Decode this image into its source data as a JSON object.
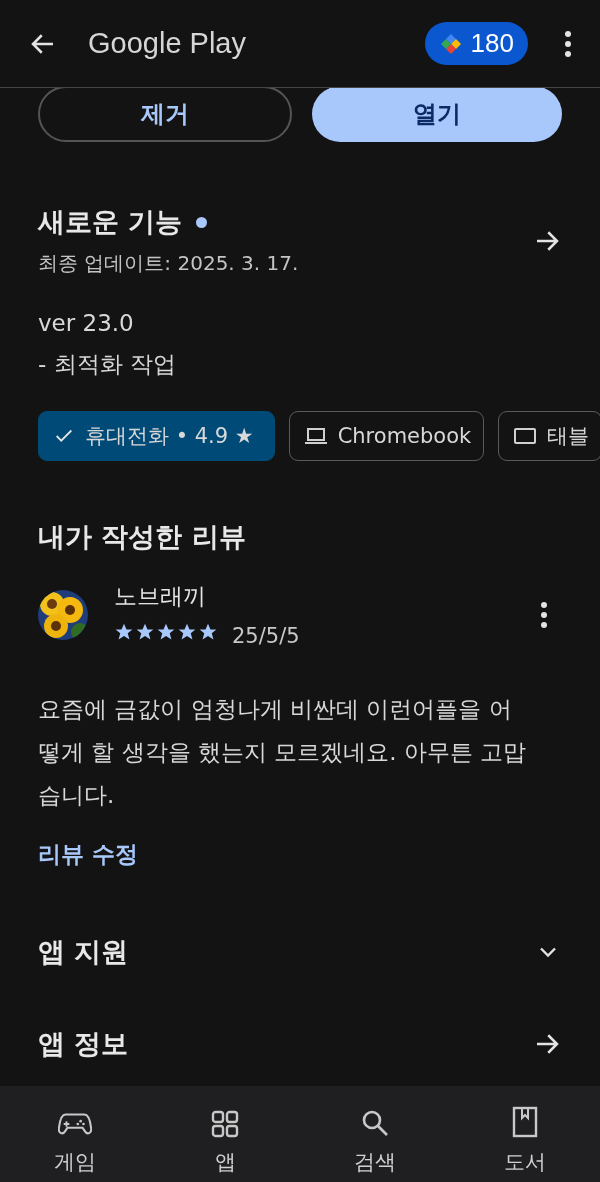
{
  "top_bar": {
    "title": "Google Play",
    "points": "180"
  },
  "actions": [
    {
      "label": "제거",
      "kind": "outline"
    },
    {
      "label": "열기",
      "kind": "filled"
    }
  ],
  "whats_new": {
    "title": "새로운 기능",
    "unread": true,
    "updated": "최종 업데이트: 2025. 3. 17.",
    "lines": [
      "ver 23.0",
      "- 최적화 작업"
    ]
  },
  "devices": [
    {
      "label": "휴대전화 • 4.9 ★",
      "selected": true
    },
    {
      "label": "Chromebook",
      "kind": "laptop",
      "selected": false
    },
    {
      "label": "태블",
      "kind": "tablet",
      "selected": false
    }
  ],
  "my_review": {
    "title": "내가 작성한 리뷰",
    "author": "노브래끼",
    "stars": 5,
    "date": "25/5/5",
    "text": "요즘에 금값이 엄청나게 비싼데 이런어플을 어떻게 할 생각을 했는지 모르겠네요. 아무튼 고맙습니다.",
    "edit_link": "리뷰 수정"
  },
  "sections": [
    {
      "title": "앱 지원",
      "kind": "expand"
    },
    {
      "title": "앱 정보",
      "kind": "link"
    }
  ],
  "nav": [
    {
      "label": "게임",
      "kind": "games"
    },
    {
      "label": "앱",
      "kind": "apps"
    },
    {
      "label": "검색",
      "kind": "search"
    },
    {
      "label": "도서",
      "kind": "books"
    }
  ]
}
